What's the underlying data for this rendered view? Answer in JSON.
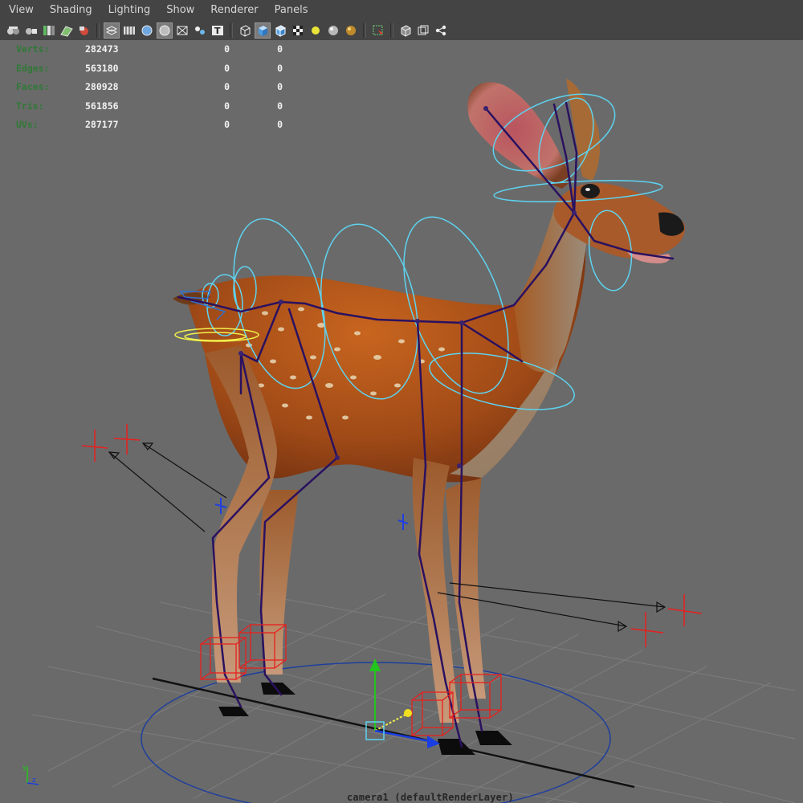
{
  "menu": {
    "items": [
      "View",
      "Shading",
      "Lighting",
      "Show",
      "Renderer",
      "Panels"
    ]
  },
  "toolbar": {
    "icons": [
      "camera-select-icon",
      "camera-lock-icon",
      "bookmark-icon",
      "image-plane-icon",
      "camera-attributes-icon",
      "wireframe-icon",
      "grid-icon",
      "smooth-shade-icon",
      "flat-shade-icon",
      "xray-icon",
      "xray-joints-icon",
      "text-icon",
      "bounding-box-icon",
      "shaded-cube-icon",
      "wireframe-on-shaded-icon",
      "textured-icon",
      "default-light-icon",
      "all-lights-icon",
      "shadows-icon",
      "isolate-select-icon",
      "cube-view-icon",
      "resolution-gate-icon",
      "share-icon"
    ],
    "active": [
      "wireframe-icon",
      "flat-shade-icon",
      "shaded-cube-icon"
    ]
  },
  "hud": {
    "rows": [
      {
        "label": "Verts:",
        "v1": "282473",
        "v2": "0",
        "v3": "0"
      },
      {
        "label": "Edges:",
        "v1": "563180",
        "v2": "0",
        "v3": "0"
      },
      {
        "label": "Faces:",
        "v1": "280928",
        "v2": "0",
        "v3": "0"
      },
      {
        "label": "Tris:",
        "v1": "561856",
        "v2": "0",
        "v3": "0"
      },
      {
        "label": "UVs:",
        "v1": "287177",
        "v2": "0",
        "v3": "0"
      }
    ]
  },
  "viewport": {
    "camera_label": "camera1 (defaultRenderLayer)",
    "colors": {
      "background": "#6a6a6a",
      "grid": "#7d7d7d",
      "fur": "#a9531c",
      "belly": "#9c8c76",
      "skeleton": "#2a1160",
      "control_curve": "#5ed3f0",
      "ik_box": "#e8201e",
      "locator": "#e8201e",
      "tail_control": "#f2f04a",
      "ground_circle": "#1f3f9c"
    },
    "axis_labels": {
      "y": "y",
      "z": "z"
    }
  }
}
